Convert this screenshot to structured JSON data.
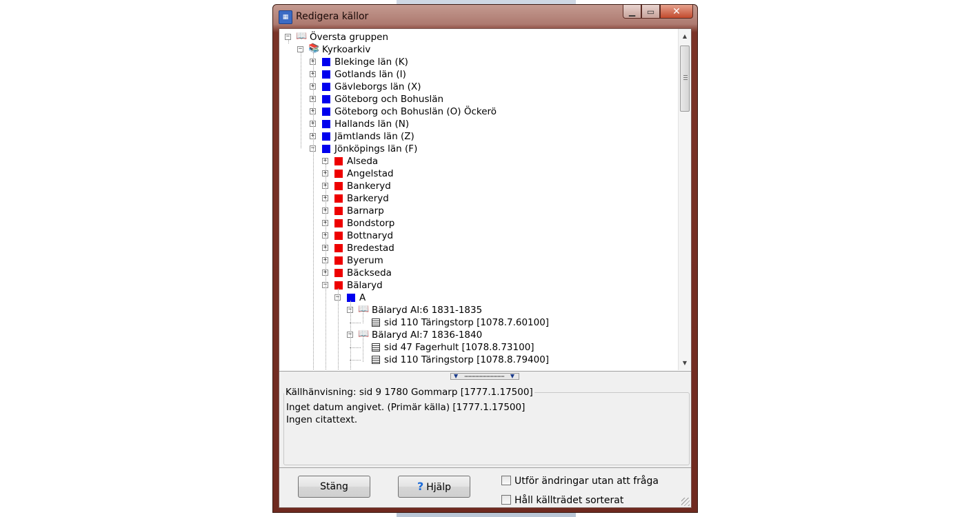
{
  "window": {
    "title": "Redigera källor",
    "minimize_glyph": "▁",
    "maximize_glyph": "▭",
    "close_glyph": "✕"
  },
  "tree": {
    "nodes": [
      {
        "label": "Översta gruppen",
        "toggle": "−",
        "icon": "book-icon"
      },
      {
        "label": "Kyrkoarkiv",
        "toggle": "−",
        "icon": "archive-icon"
      },
      {
        "label": "Blekinge län (K)",
        "toggle": "+",
        "icon": "blue-square"
      },
      {
        "label": "Gotlands län (I)",
        "toggle": "+",
        "icon": "blue-square"
      },
      {
        "label": "Gävleborgs län (X)",
        "toggle": "+",
        "icon": "blue-square"
      },
      {
        "label": "Göteborg och Bohuslän",
        "toggle": "+",
        "icon": "blue-square"
      },
      {
        "label": "Göteborg och Bohuslän (O) Öckerö",
        "toggle": "+",
        "icon": "blue-square"
      },
      {
        "label": "Hallands län (N)",
        "toggle": "+",
        "icon": "blue-square"
      },
      {
        "label": "Jämtlands län (Z)",
        "toggle": "+",
        "icon": "blue-square"
      },
      {
        "label": "Jönköpings län (F)",
        "toggle": "−",
        "icon": "blue-square"
      },
      {
        "label": "Alseda",
        "toggle": "+",
        "icon": "red-square"
      },
      {
        "label": "Angelstad",
        "toggle": "+",
        "icon": "red-square"
      },
      {
        "label": "Bankeryd",
        "toggle": "+",
        "icon": "red-square"
      },
      {
        "label": "Barkeryd",
        "toggle": "+",
        "icon": "red-square"
      },
      {
        "label": "Barnarp",
        "toggle": "+",
        "icon": "red-square"
      },
      {
        "label": "Bondstorp",
        "toggle": "+",
        "icon": "red-square"
      },
      {
        "label": "Bottnaryd",
        "toggle": "+",
        "icon": "red-square"
      },
      {
        "label": "Bredestad",
        "toggle": "+",
        "icon": "red-square"
      },
      {
        "label": "Byerum",
        "toggle": "+",
        "icon": "red-square"
      },
      {
        "label": "Bäckseda",
        "toggle": "+",
        "icon": "red-square"
      },
      {
        "label": "Bälaryd",
        "toggle": "−",
        "icon": "red-square"
      },
      {
        "label": "A",
        "toggle": "−",
        "icon": "blue-square"
      },
      {
        "label": "Bälaryd AI:6 1831-1835",
        "toggle": "−",
        "icon": "book-icon"
      },
      {
        "label": "sid  110 Täringstorp [1078.7.60100]",
        "toggle": "",
        "icon": "page-icon"
      },
      {
        "label": "Bälaryd AI:7 1836-1840",
        "toggle": "−",
        "icon": "book-icon"
      },
      {
        "label": "sid  47 Fagerhult [1078.8.73100]",
        "toggle": "",
        "icon": "page-icon"
      },
      {
        "label": "sid  110 Täringstorp [1078.8.79400]",
        "toggle": "",
        "icon": "page-icon"
      }
    ]
  },
  "scrollbar": {
    "up_glyph": "▲",
    "down_glyph": "▼"
  },
  "splitter": {
    "left_glyph": "▼",
    "right_glyph": "▼"
  },
  "reference": {
    "legend": "Källhänvisning: sid  9 1780 Gommarp [1777.1.17500]",
    "line1": "Inget datum angivet. (Primär källa) [1777.1.17500]",
    "line2": "Ingen citattext."
  },
  "buttons": {
    "close_label": "Stäng",
    "help_icon": "?",
    "help_label": "Hjälp"
  },
  "options": {
    "apply_without_asking": {
      "label": "Utför ändringar utan att fråga",
      "checked": false
    },
    "keep_sorted": {
      "label": "Håll källträdet sorterat",
      "checked": false
    }
  }
}
